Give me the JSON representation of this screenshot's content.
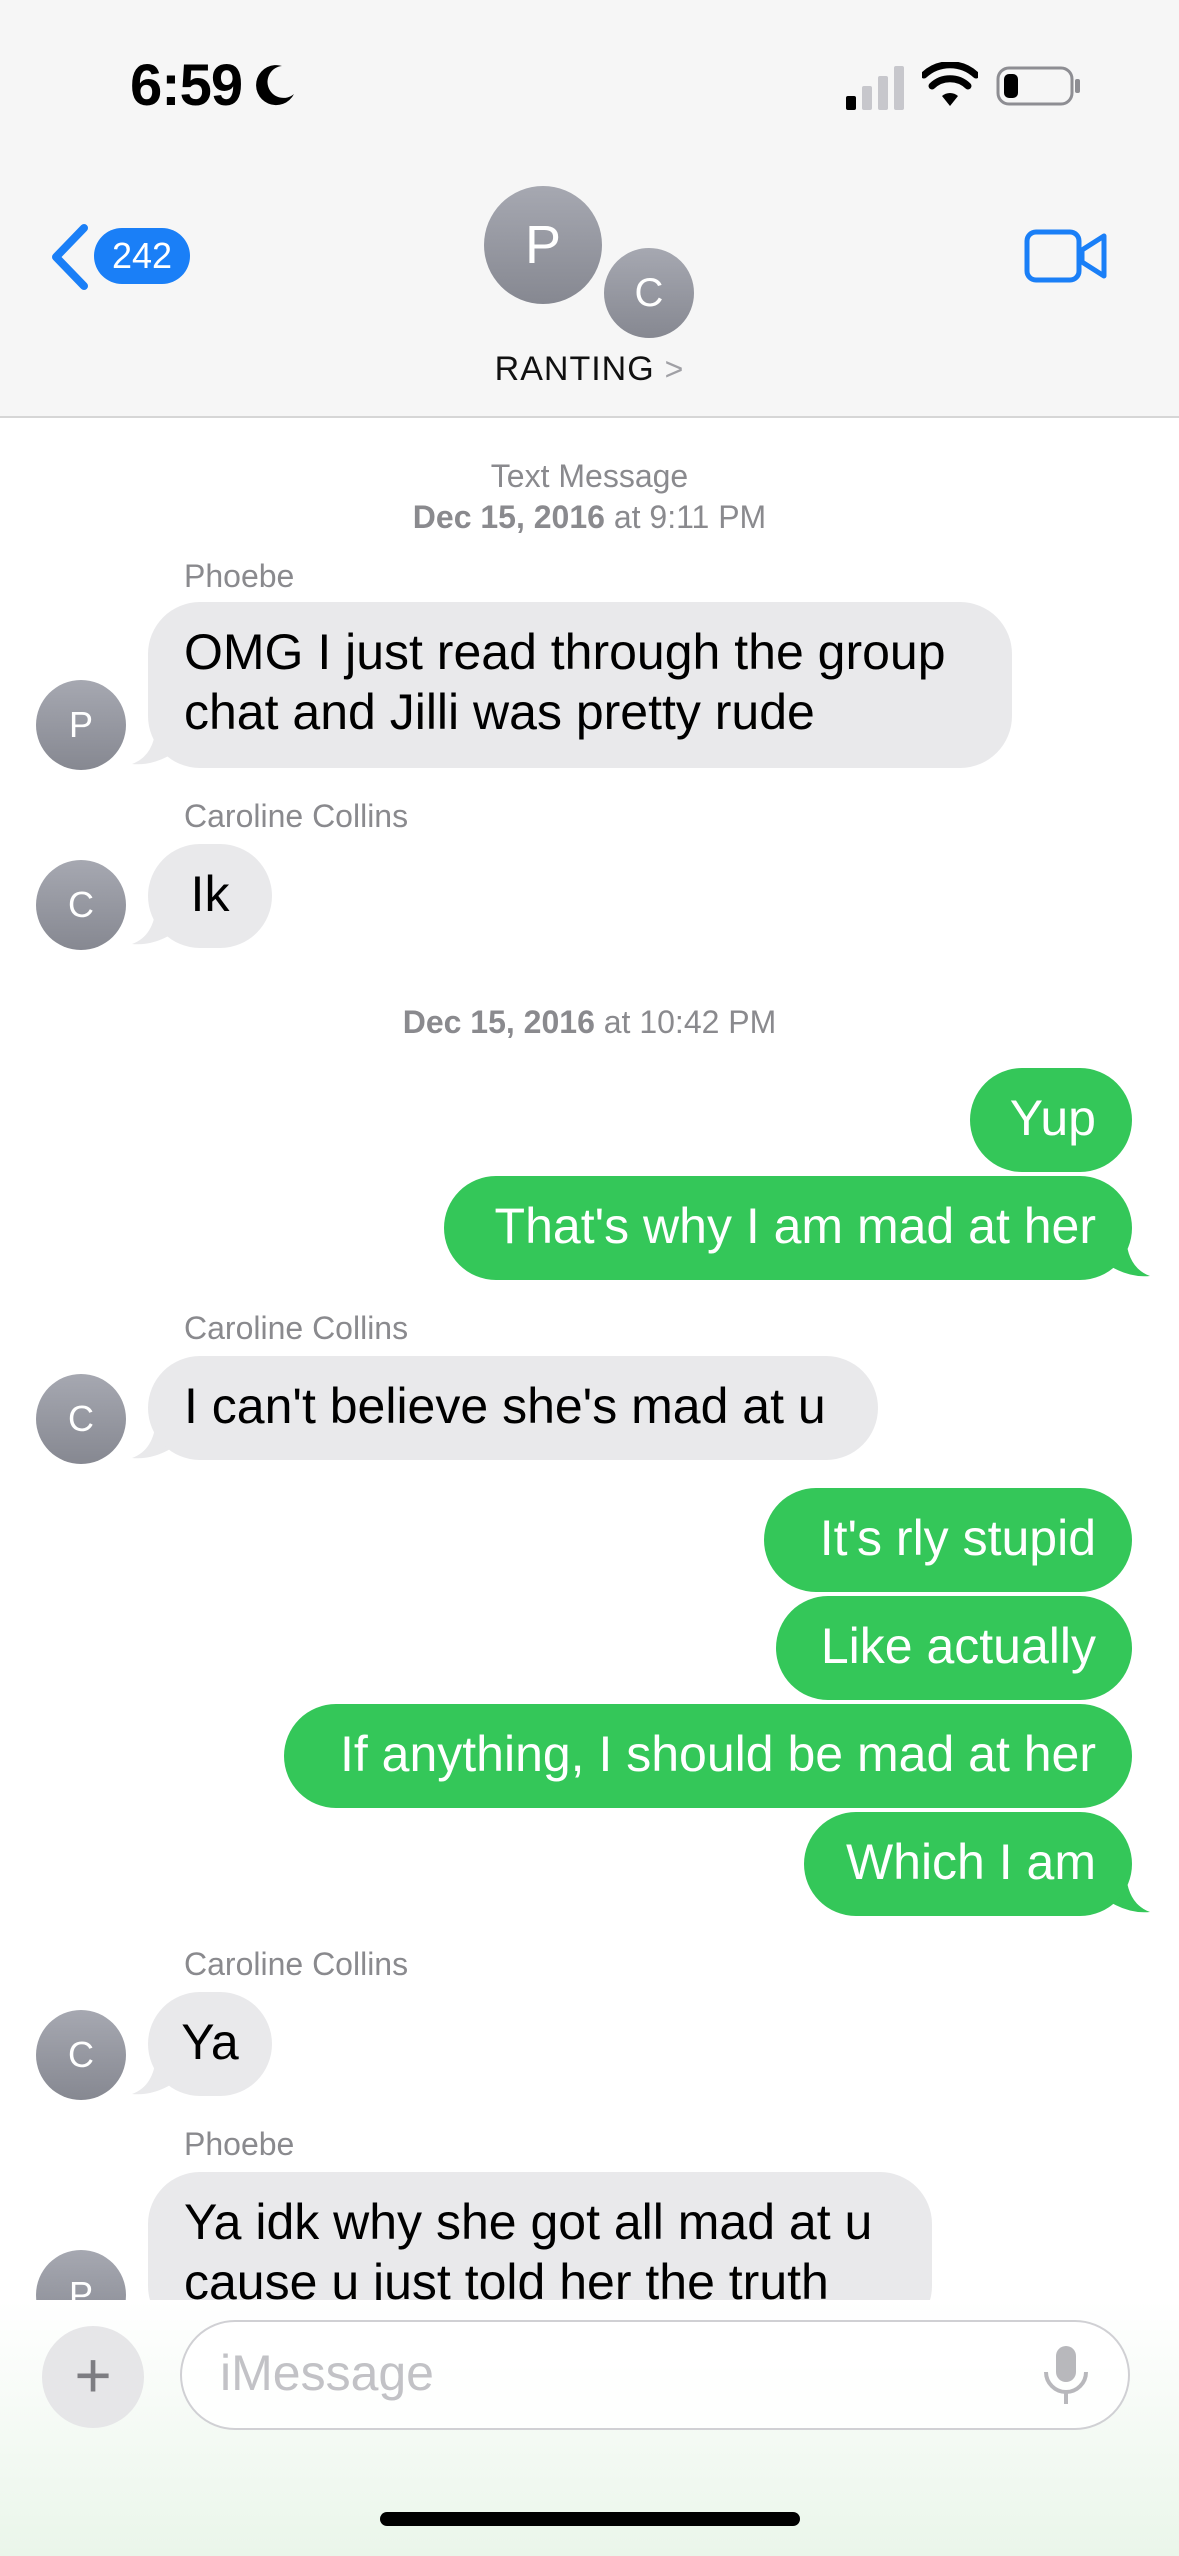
{
  "status_bar": {
    "time": "6:59",
    "focus_icon": "moon-icon"
  },
  "header": {
    "back_count": "242",
    "avatar_p": "P",
    "avatar_c": "C",
    "group_name": "RANTING",
    "chevron": ">"
  },
  "messages": {
    "ts1_a": "Text Message",
    "ts1_date": "Dec 15, 2016",
    "ts1_at": "at 9:11 PM",
    "phoebe_label_1": "Phoebe",
    "m1": [
      "OMG I just read through the group",
      "chat and Jilli was pretty rude"
    ],
    "caroline_label_1": "Caroline Collins",
    "m2": "Ik",
    "ts2_date": "Dec 15, 2016",
    "ts2_at": "at 10:42 PM",
    "m3": "Yup",
    "m4": "That's why I am mad at her",
    "caroline_label_2": "Caroline Collins",
    "m5": "I can't believe she's mad at u",
    "m6": "It's rly stupid",
    "m7": "Like actually",
    "m8": "If anything, I should be mad at her",
    "m9": "Which I am",
    "caroline_label_3": "Caroline Collins",
    "m10": "Ya",
    "phoebe_label_2": "Phoebe",
    "m11": [
      "Ya idk why she got all mad at u",
      "cause u just told her the truth"
    ],
    "avatar_letters": {
      "p": "P",
      "c": "C"
    }
  },
  "input": {
    "placeholder": "iMessage",
    "plus": "+"
  },
  "colors": {
    "accent": "#1a7ff7",
    "sent_bubble": "#34c759",
    "received_bubble": "#e9e9eb"
  }
}
